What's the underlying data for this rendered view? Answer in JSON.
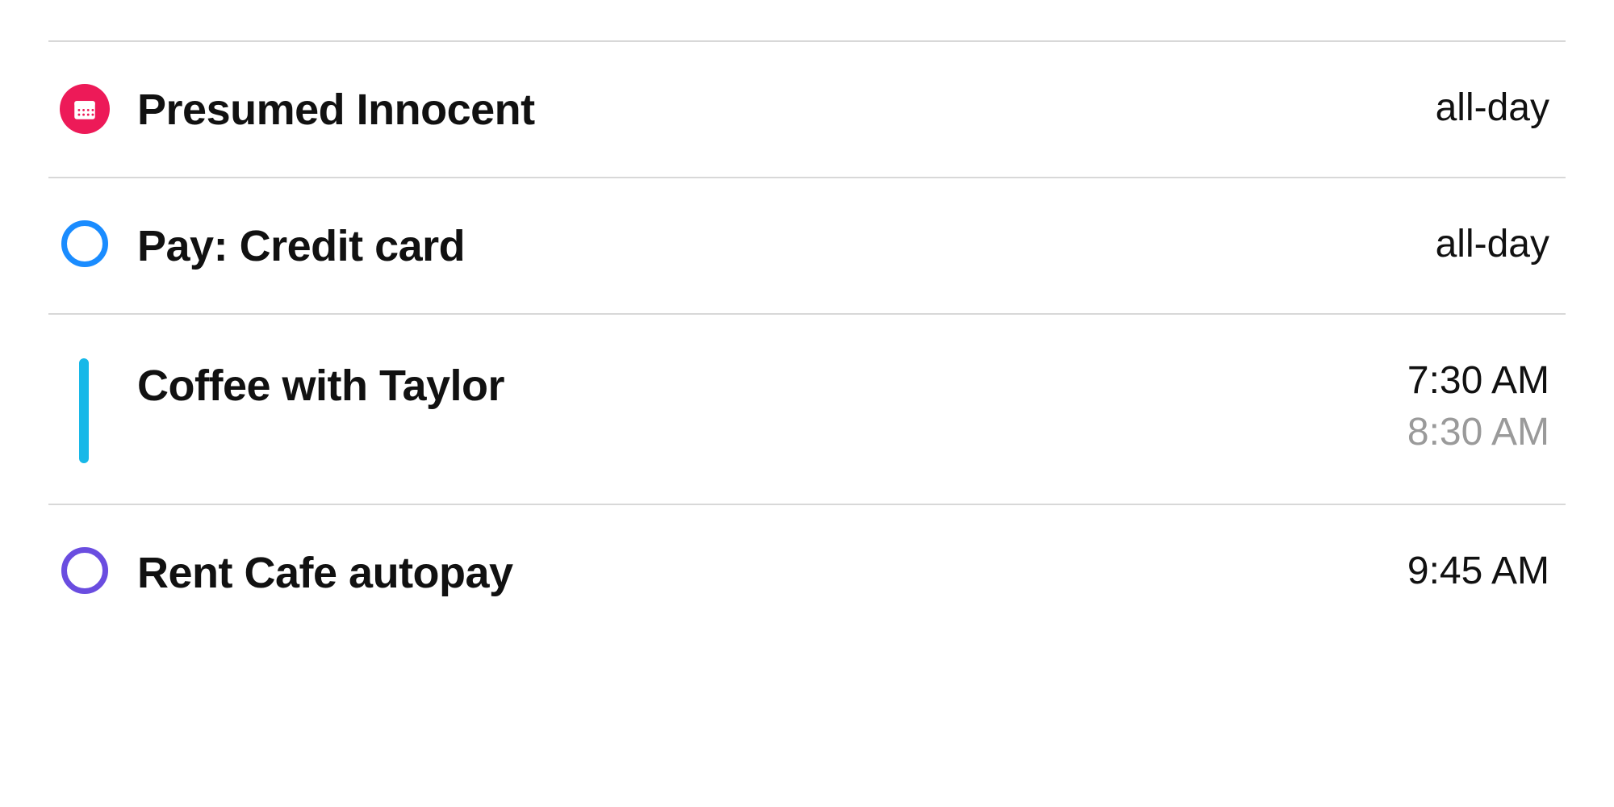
{
  "events": [
    {
      "title": "Presumed Innocent",
      "time_primary": "all-day",
      "time_secondary": null,
      "icon": "calendar-badge",
      "color": "#ed1a58"
    },
    {
      "title": "Pay: Credit card",
      "time_primary": "all-day",
      "time_secondary": null,
      "icon": "ring",
      "color": "#1a8cff"
    },
    {
      "title": "Coffee with Taylor",
      "time_primary": "7:30 AM",
      "time_secondary": "8:30 AM",
      "icon": "bar",
      "color": "#17b8e8"
    },
    {
      "title": "Rent Cafe autopay",
      "time_primary": "9:45 AM",
      "time_secondary": null,
      "icon": "ring",
      "color": "#6a4de0"
    }
  ]
}
